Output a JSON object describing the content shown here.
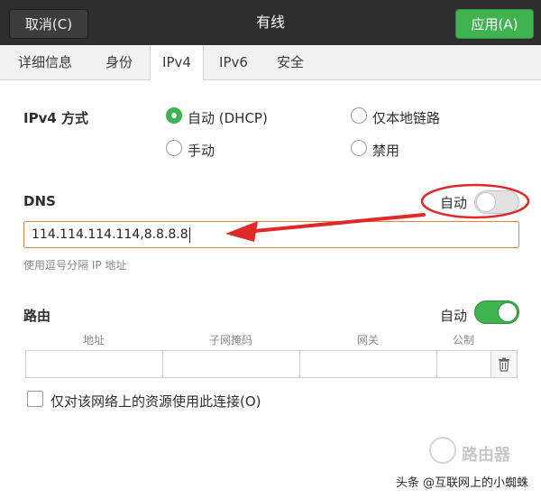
{
  "header": {
    "cancel_label": "取消(C)",
    "title": "有线",
    "apply_label": "应用(A)"
  },
  "tabs": [
    {
      "label": "详细信息"
    },
    {
      "label": "身份"
    },
    {
      "label": "IPv4",
      "active": true
    },
    {
      "label": "IPv6"
    },
    {
      "label": "安全"
    }
  ],
  "ipv4": {
    "method_label": "IPv4 方式",
    "options": {
      "auto": "自动 (DHCP)",
      "link_local": "仅本地链路",
      "manual": "手动",
      "disabled": "禁用"
    },
    "selected": "auto"
  },
  "dns": {
    "label": "DNS",
    "auto_label": "自动",
    "auto_enabled": false,
    "value": "114.114.114.114,8.8.8.8",
    "hint": "使用逗号分隔 IP 地址"
  },
  "routes": {
    "label": "路由",
    "auto_label": "自动",
    "auto_enabled": true,
    "columns": [
      "地址",
      "子网掩码",
      "网关",
      "公制"
    ]
  },
  "only_local_resources_label": "仅对该网络上的资源使用此连接(O)",
  "watermark": {
    "router_text": "路由器",
    "credit": "头条 @互联网上的小蜘蛛"
  },
  "colors": {
    "accent_green": "#3eb34f",
    "annotation_red": "#e02a2a",
    "input_focus": "#e3853f"
  },
  "icons": {
    "trash": "trash-icon"
  }
}
